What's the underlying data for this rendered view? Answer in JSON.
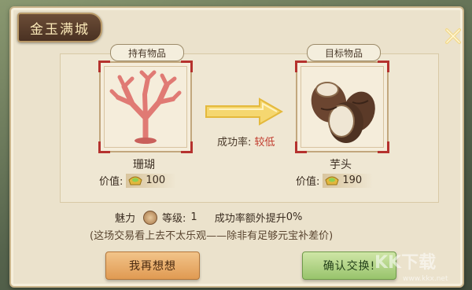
{
  "title": "金玉满城",
  "held": {
    "label": "持有物品",
    "name": "珊瑚",
    "value_label": "价值:",
    "value": "100"
  },
  "target": {
    "label": "目标物品",
    "name": "芋头",
    "value_label": "价值:",
    "value": "190"
  },
  "success_rate": {
    "label": "成功率:",
    "value": "较低"
  },
  "charm": {
    "label": "魅力",
    "level_label": "等级:",
    "level": "1",
    "bonus_label": "成功率额外提升",
    "bonus": "0%"
  },
  "note": "(这场交易看上去不太乐观——除非有足够元宝补差价)",
  "buttons": {
    "reconsider": "我再想想",
    "confirm": "确认交换!"
  },
  "watermark": {
    "text": "KK下载",
    "url": "www.kkx.net"
  },
  "icons": [
    "close-icon",
    "arrow-right-icon",
    "coral-icon",
    "taro-icon",
    "gold-ingot-icon",
    "charm-coin-icon"
  ]
}
